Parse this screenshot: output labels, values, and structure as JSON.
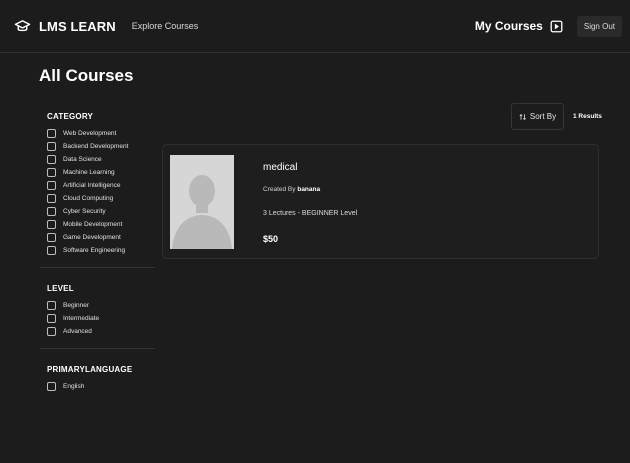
{
  "header": {
    "brand": "LMS LEARN",
    "explore": "Explore Courses",
    "my_courses": "My Courses",
    "sign_out": "Sign Out"
  },
  "page": {
    "title": "All Courses"
  },
  "filters": [
    {
      "title": "CATEGORY",
      "options": [
        "Web Development",
        "Backend Development",
        "Data Science",
        "Machine Learning",
        "Artificial Intelligence",
        "Cloud Computing",
        "Cyber Security",
        "Mobile Development",
        "Game Development",
        "Software Engineering"
      ]
    },
    {
      "title": "LEVEL",
      "options": [
        "Beginner",
        "Intermediate",
        "Advanced"
      ]
    },
    {
      "title": "PRIMARYLANGUAGE",
      "options": [
        "English"
      ]
    }
  ],
  "sort": {
    "label": "Sort By"
  },
  "results": "1 Results",
  "course": {
    "title": "medical",
    "created_by_label": "Created By",
    "creator": "banana",
    "meta": "3 Lectures - BEGINNER Level",
    "price": "$50"
  },
  "icons": {
    "brand": "graduation-cap-icon",
    "my_courses": "play-square-icon",
    "sort": "sort-arrows-icon"
  }
}
